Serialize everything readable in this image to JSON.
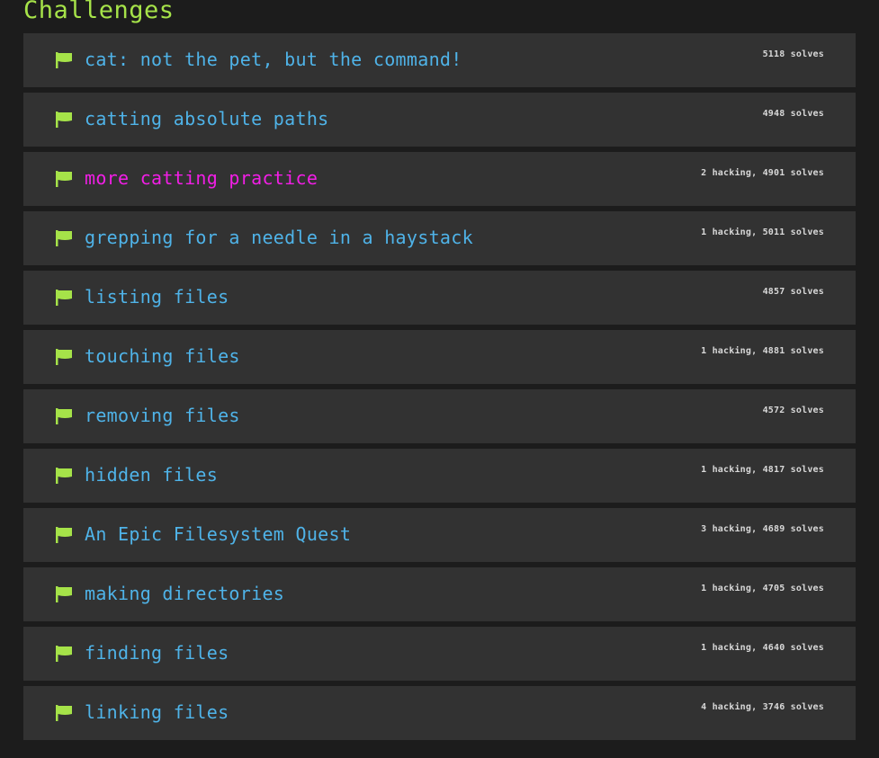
{
  "page": {
    "heading": "Challenges",
    "colors": {
      "background": "#1c1c1c",
      "row": "#323232",
      "heading": "#a6e349",
      "title": "#4fb3e8",
      "title_active": "#f21ee6",
      "flag": "#a6e349",
      "stats": "#d8d8d8"
    }
  },
  "challenges": [
    {
      "title": "cat: not the pet, but the command!",
      "stats": "5118 solves",
      "icon": "flag-icon",
      "active": false
    },
    {
      "title": "catting absolute paths",
      "stats": "4948 solves",
      "icon": "flag-icon",
      "active": false
    },
    {
      "title": "more catting practice",
      "stats": "2 hacking, 4901 solves",
      "icon": "flag-icon",
      "active": true
    },
    {
      "title": "grepping for a needle in a haystack",
      "stats": "1 hacking, 5011 solves",
      "icon": "flag-icon",
      "active": false
    },
    {
      "title": "listing files",
      "stats": "4857 solves",
      "icon": "flag-icon",
      "active": false
    },
    {
      "title": "touching files",
      "stats": "1 hacking, 4881 solves",
      "icon": "flag-icon",
      "active": false
    },
    {
      "title": "removing files",
      "stats": "4572 solves",
      "icon": "flag-icon",
      "active": false
    },
    {
      "title": "hidden files",
      "stats": "1 hacking, 4817 solves",
      "icon": "flag-icon",
      "active": false
    },
    {
      "title": "An Epic Filesystem Quest",
      "stats": "3 hacking, 4689 solves",
      "icon": "flag-icon",
      "active": false
    },
    {
      "title": "making directories",
      "stats": "1 hacking, 4705 solves",
      "icon": "flag-icon",
      "active": false
    },
    {
      "title": "finding files",
      "stats": "1 hacking, 4640 solves",
      "icon": "flag-icon",
      "active": false
    },
    {
      "title": "linking files",
      "stats": "4 hacking, 3746 solves",
      "icon": "flag-icon",
      "active": false
    }
  ]
}
